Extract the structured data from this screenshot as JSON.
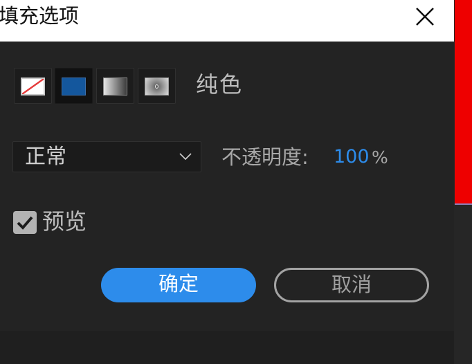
{
  "dialog": {
    "title": "填充选项",
    "close_icon": "close-icon"
  },
  "fill": {
    "types": [
      {
        "id": "none",
        "icon": "no-fill-icon",
        "selected": false
      },
      {
        "id": "solid",
        "icon": "solid-color-icon",
        "selected": true
      },
      {
        "id": "linear",
        "icon": "linear-gradient-icon",
        "selected": false
      },
      {
        "id": "radial",
        "icon": "radial-gradient-icon",
        "selected": false
      }
    ],
    "current_label": "纯色",
    "solid_color": "#14579d"
  },
  "blend": {
    "mode": "正常",
    "icon": "chevron-down-icon"
  },
  "opacity": {
    "label": "不透明度:",
    "value": "100",
    "unit": "%"
  },
  "preview": {
    "label": "预览",
    "checked": true
  },
  "buttons": {
    "ok_label": "确定",
    "cancel_label": "取消"
  },
  "colors": {
    "accent": "#2d8ceb",
    "background": "#232323",
    "titlebar": "#ffffff",
    "side_strip": "#ee0000"
  }
}
